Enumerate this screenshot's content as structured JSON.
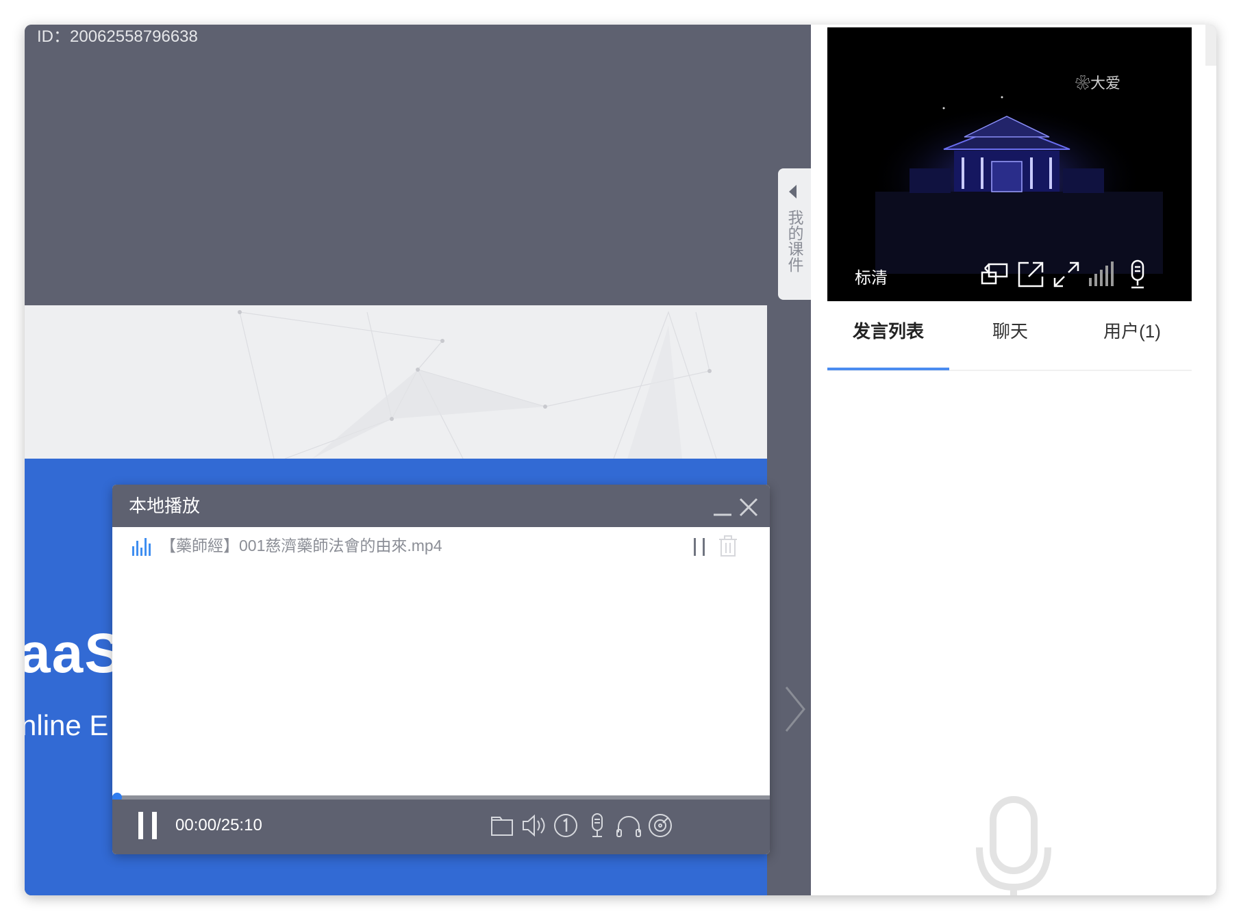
{
  "stage": {
    "id_label": "ID：20062558796638",
    "course_tab_label": "我的课件",
    "slide_big_text": "aaS",
    "slide_sub_text": "nline E"
  },
  "player": {
    "title": "本地播放",
    "track_name": "【藥師經】001慈濟藥師法會的由來.mp4",
    "time": "00:00/25:10",
    "progress": 0.0,
    "controls": [
      "folder-icon",
      "volume-icon",
      "speed-1x-icon",
      "mic-icon",
      "headphones-icon",
      "record-disc-icon"
    ]
  },
  "video": {
    "logo_text": "大爱",
    "quality_label": "标清",
    "icons": [
      "switch-layout-icon",
      "popout-icon",
      "fullscreen-icon",
      "signal-icon",
      "mic-icon"
    ]
  },
  "tabs": [
    {
      "label": "发言列表",
      "active": true
    },
    {
      "label": "聊天",
      "active": false
    },
    {
      "label": "用户(1)",
      "active": false
    }
  ],
  "colors": {
    "stage_bg": "#5e6170",
    "slide_blue": "#326ad4",
    "accent": "#4a8cf0",
    "progress_knob": "#2f7cf0"
  }
}
